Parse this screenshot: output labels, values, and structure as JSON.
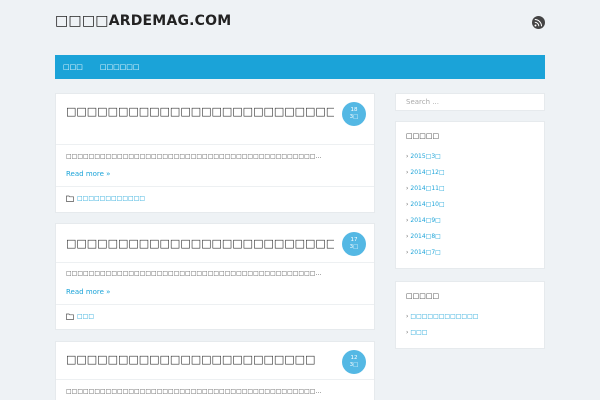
{
  "header": {
    "site_title": "□□□□ARDEMAG.COM",
    "rss_icon": "rss-icon"
  },
  "nav": {
    "items": [
      "□□□",
      "□□□□□□"
    ]
  },
  "posts": [
    {
      "title": "□□□□□□□□□□□□□□□□□□□□□□□□□□□□□□□□□□□□□□□□□□□□□□□□□□□□□□□□□□□□□□",
      "day": "18",
      "month": "3□",
      "excerpt": "□□□□□□□□□□□□□□□□□□□□□□□□□□□□□□□□□□□□□□□□□□□□…",
      "readmore": "Read more »",
      "category": "□□□□□□□□□□□□"
    },
    {
      "title": "□□□□□□□□□□□□□□□□□□□□□□□□□□□□□□□□□□",
      "day": "17",
      "month": "3□",
      "excerpt": "□□□□□□□□□□□□□□□□□□□□□□□□□□□□□□□□□□□□□□□□□□□□…",
      "readmore": "Read more »",
      "category": "□□□"
    },
    {
      "title": "□□□□□□□□□□□□□□□□□□□□□□□□",
      "day": "12",
      "month": "3□",
      "excerpt": "□□□□□□□□□□□□□□□□□□□□□□□□□□□□□□□□□□□□□□□□□□□□…"
    }
  ],
  "sidebar": {
    "search_placeholder": "Search ...",
    "archives": {
      "title": "□□□□□",
      "items": [
        "2015□3□",
        "2014□12□",
        "2014□11□",
        "2014□10□",
        "2014□9□",
        "2014□8□",
        "2014□7□"
      ]
    },
    "categories": {
      "title": "□□□□□",
      "items": [
        "□□□□□□□□□□□□",
        "□□□"
      ]
    }
  },
  "colors": {
    "accent": "#1ba3d8",
    "badge": "#54b8e4",
    "background": "#eef2f5"
  }
}
